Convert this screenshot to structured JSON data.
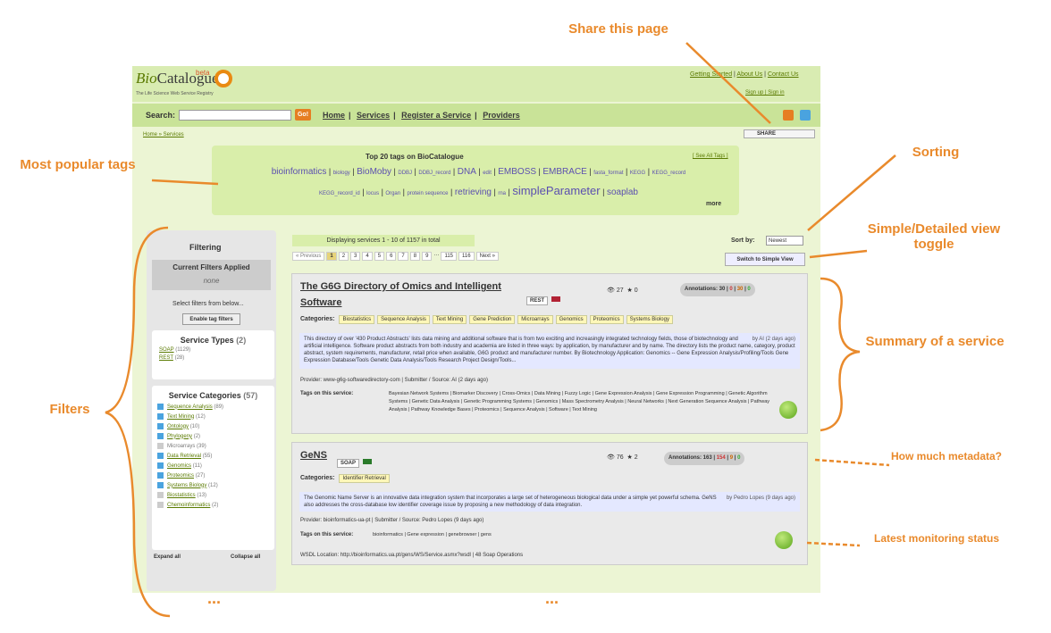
{
  "app": {
    "logo": "BioCatalogue",
    "logo_prefix": "Bio",
    "logo_suffix": "Catalogue",
    "beta": "beta",
    "tagline": "The Life Science Web Service Registry"
  },
  "toplinks": [
    "Getting Started",
    "About Us",
    "Contact Us"
  ],
  "signin": "Sign up  |  Sign in",
  "search": {
    "label": "Search:",
    "value": "",
    "go": "Go!"
  },
  "nav": [
    "Home",
    "Services",
    "Register a Service",
    "Providers"
  ],
  "breadcrumb": "Home » Services",
  "share": "SHARE",
  "tagcloud": {
    "title": "Top 20 tags on BioCatalogue",
    "see_all": "[ See All Tags ]",
    "more": "more",
    "row1": [
      "bioinformatics",
      "biology",
      "BioMoby",
      "DDBJ",
      "DDBJ_record",
      "DNA",
      "edit",
      "EMBOSS",
      "EMBRACE",
      "fasta_format",
      "KEGG",
      "KEGG_record"
    ],
    "row2": [
      "KEGG_record_id",
      "locus",
      "Organ",
      "protein sequence",
      "retrieving",
      "rna",
      "simpleParameter",
      "soaplab"
    ]
  },
  "filtering": {
    "title": "Filtering",
    "current": "Current Filters Applied",
    "none": "none",
    "select": "Select filters from below...",
    "enable": "Enable tag filters",
    "types_title": "Service Types",
    "types_count": "(2)",
    "types": [
      {
        "label": "SOAP",
        "count": "(1129)"
      },
      {
        "label": "REST",
        "count": "(28)"
      }
    ],
    "cats_title": "Service Categories",
    "cats_count": "(57)",
    "categories": [
      {
        "label": "Sequence Analysis",
        "count": "(89)"
      },
      {
        "label": "Text Mining",
        "count": "(12)"
      },
      {
        "label": "Ontology",
        "count": "(10)"
      },
      {
        "label": "Phylogeny",
        "count": "(2)"
      },
      {
        "label": "Microarrays",
        "count": "(39)"
      },
      {
        "label": "Data Retrieval",
        "count": "(55)"
      },
      {
        "label": "Genomics",
        "count": "(11)"
      },
      {
        "label": "Proteomics",
        "count": "(27)"
      },
      {
        "label": "Systems Biology",
        "count": "(12)"
      },
      {
        "label": "Biostatistics",
        "count": "(13)"
      },
      {
        "label": "Chemoinformatics",
        "count": "(2)"
      }
    ],
    "expand": "Expand all",
    "collapse": "Collapse all"
  },
  "results": {
    "displaying": "Displaying services 1 - 10 of 1157 in total",
    "prev": "« Previous",
    "pages": [
      "1",
      "2",
      "3",
      "4",
      "5",
      "6",
      "7",
      "8",
      "9",
      "…",
      "115",
      "116"
    ],
    "next": "Next »",
    "sort_label": "Sort by:",
    "sort_value": "Newest",
    "switch": "Switch to Simple View"
  },
  "services": [
    {
      "name1": "The G6G Directory of Omics and Intelligent",
      "name2": "Software",
      "type": "REST",
      "views": "27",
      "stars": "0",
      "annotations": "Annotations: 30",
      "a1": "0",
      "a2": "30",
      "a3": "0",
      "categories_label": "Categories:",
      "categories": [
        "Biostatistics",
        "Sequence Analysis",
        "Text Mining",
        "Gene Prediction",
        "Microarrays",
        "Genomics",
        "Proteomics",
        "Systems Biology"
      ],
      "desc": "This directory of over '430 Product Abstracts' lists data mining and additional software that is from two exciting and increasingly integrated technology fields, those of biotechnology and artificial intelligence. Software product abstracts from both industry and academia are listed in three ways: by application, by manufacturer and by name. The directory lists the product name, category, product abstract, system requirements, manufacturer, retail price when available, G6G product and manufacturer number. By Biotechnology Application: Genomics -- Gene Expression Analysis/Profiling/Tools Gene Expression Database/Tools Genetic Data Analysis/Tools Research Project Design/Tools...",
      "desc_by": "by  AI (2 days ago)",
      "provider": "Provider: www-g6g-softwaredirectory-com | Submitter / Source: AI (2 days ago)",
      "tags_label": "Tags on this service:",
      "tags": "Bayesian Network Systems | Biomarker Discovery | Cross-Omics | Data Mining | Fuzzy Logic | Gene Expression Analysis | Gene Expression Programming | Genetic Algorithm Systems | Genetic Data Analysis | Genetic Programming Systems | Genomics | Mass Spectrometry Analysis | Neural Networks | Next Generation Sequence Analysis | Pathway Analysis | Pathway Knowledge Bases | Proteomics | Sequence Analysis | Software | Text Mining"
    },
    {
      "name1": "GeNS",
      "type": "SOAP",
      "views": "76",
      "stars": "2",
      "annotations": "Annotations: 163",
      "a1": "154",
      "a2": "9",
      "a3": "0",
      "categories_label": "Categories:",
      "categories": [
        "Identifier Retrieval"
      ],
      "desc": "The Genomic Name Server is an innovative data integration system that incorporates a large set of heterogeneous biological data under a simple yet powerful schema. GeNS also addresses the cross-database low identifier coverage issue by proposing a new methodology of data integration.",
      "desc_by": "by  Pedro Lopes (9 days ago)",
      "provider": "Provider: bioinformatics-ua-pt | Submitter / Source: Pedro Lopes (9 days ago)",
      "tags_label": "Tags on this service:",
      "tags": "bioinformatics | Gene expression | genebrowser | gens",
      "wsdl": "WSDL Location: http://bioinformatics.ua.pt/gens/WS/Service.asmx?wsdl | 48 Soap Operations"
    }
  ],
  "annotations": {
    "share": "Share this page",
    "tags": "Most popular tags",
    "sorting": "Sorting",
    "toggle": "Simple/Detailed view toggle",
    "summary": "Summary of a service",
    "filters": "Filters",
    "metadata": "How much metadata?",
    "monitoring": "Latest monitoring status",
    "dots": "..."
  },
  "colors": {
    "accent": "#e98a2c",
    "green": "#5a7a00"
  }
}
